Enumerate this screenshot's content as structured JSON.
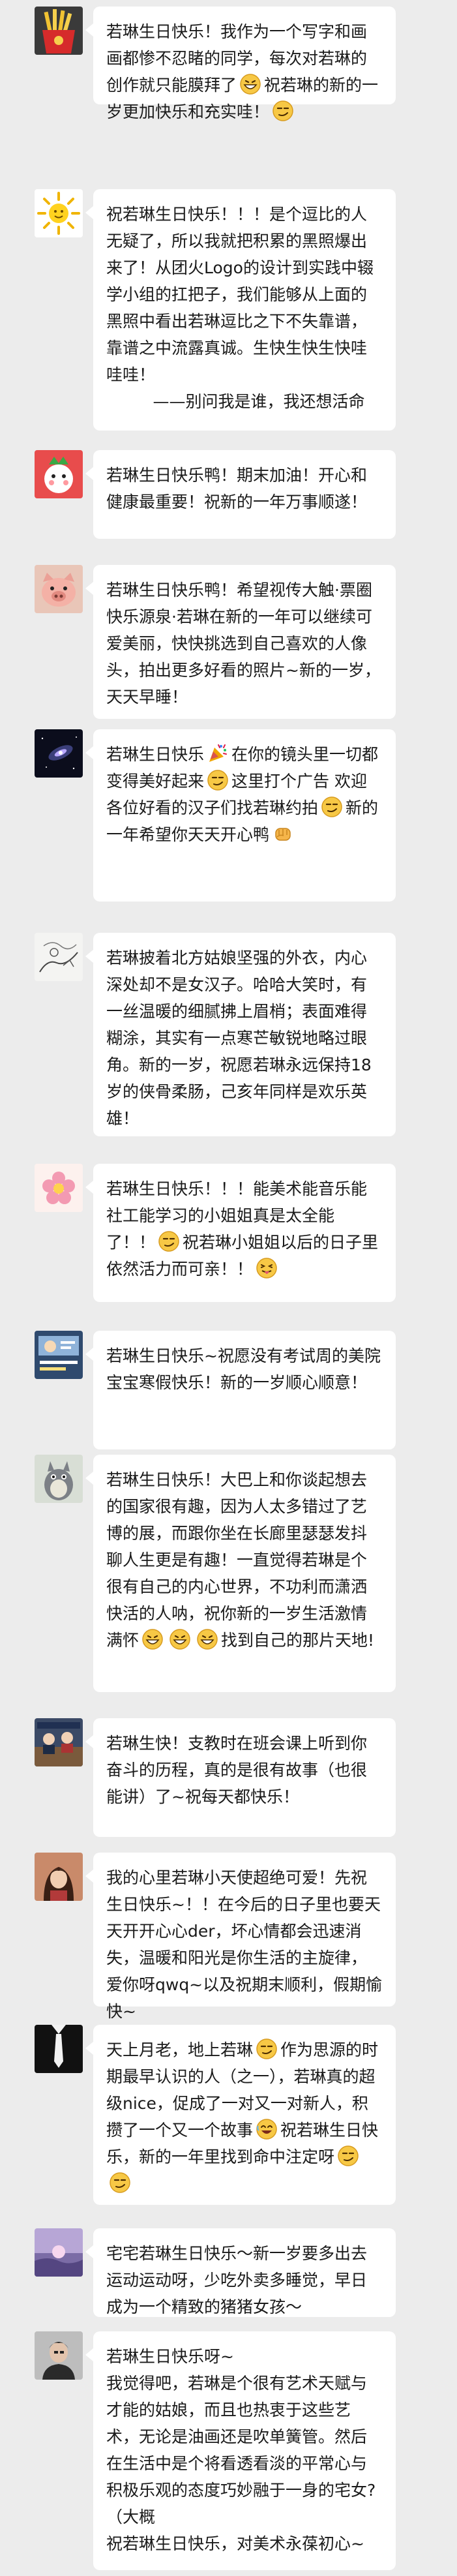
{
  "messages": [
    {
      "avatar": "fries-avatar",
      "segments": [
        {
          "t": "若琳生日快乐！我作为一个写字和画画都惨不忍睹的同学，每次对若琳的创作就只能膜拜了"
        },
        {
          "e": "grin-emoji"
        },
        {
          "t": "祝若琳的新的一岁更加快乐和充实哇！"
        },
        {
          "e": "smirk-emoji"
        }
      ]
    },
    {
      "avatar": "sun-avatar",
      "segments": [
        {
          "t": "祝若琳生日快乐！！！是个逗比的人无疑了，所以我就把积累的黑照爆出来了！从团火Logo的设计到实践中辍学小组的扛把子，我们能够从上面的黑照中看出若琳逗比之下不失靠谱，靠谱之中流露真诚。生快生快生快哇哇哇！\n         ——别问我是谁，我还想活命"
        }
      ]
    },
    {
      "avatar": "strawberry-avatar",
      "segments": [
        {
          "t": "若琳生日快乐鸭！期末加油！开心和健康最重要！祝新的一年万事顺遂！"
        }
      ]
    },
    {
      "avatar": "pig-avatar",
      "segments": [
        {
          "t": "若琳生日快乐鸭！希望视传大触·票圈快乐源泉·若琳在新的一年可以继续可爱美丽，快快挑选到自己喜欢的人像头，拍出更多好看的照片~新的一岁，天天早睡！"
        }
      ]
    },
    {
      "avatar": "galaxy-avatar",
      "segments": [
        {
          "t": "若琳生日快乐"
        },
        {
          "e": "party-emoji"
        },
        {
          "t": "在你的镜头里一切都变得美好起来"
        },
        {
          "e": "smirk-emoji"
        },
        {
          "t": "这里打个广告 欢迎各位好看的汉子们找若琳约拍"
        },
        {
          "e": "smirk-emoji"
        },
        {
          "t": "新的一年希望你天天开心鸭"
        },
        {
          "e": "fist-emoji"
        }
      ]
    },
    {
      "avatar": "sketch-avatar",
      "segments": [
        {
          "t": "若琳披着北方姑娘坚强的外衣，内心深处却不是女汉子。哈哈大笑时，有一丝温暖的细腻拂上眉梢；表面难得糊涂，其实有一点寒芒敏锐地略过眼角。新的一岁，祝愿若琳永远保持18岁的侠骨柔肠，己亥年同样是欢乐英雄！"
        }
      ]
    },
    {
      "avatar": "flower-avatar",
      "segments": [
        {
          "t": "若琳生日快乐！！！能美术能音乐能社工能学习的小姐姐真是太全能了！！"
        },
        {
          "e": "smirk-emoji"
        },
        {
          "t": "祝若琳小姐姐以后的日子里依然活力而可亲！！"
        },
        {
          "e": "tongue-emoji"
        }
      ]
    },
    {
      "avatar": "poster-avatar",
      "segments": [
        {
          "t": "若琳生日快乐~祝愿没有考试周的美院宝宝寒假快乐！新的一岁顺心顺意！"
        }
      ]
    },
    {
      "avatar": "totoro-avatar",
      "segments": [
        {
          "t": "若琳生日快乐！大巴上和你谈起想去的国家很有趣，因为人太多错过了艺博的展，而跟你坐在长廊里瑟瑟发抖聊人生更是有趣！一直觉得若琳是个很有自己的内心世界，不功利而潇洒快活的人呐，祝你新的一岁生活激情满怀"
        },
        {
          "e": "grin-emoji"
        },
        {
          "e": "grin-emoji"
        },
        {
          "e": "grin-emoji"
        },
        {
          "t": "找到自己的那片天地!"
        }
      ]
    },
    {
      "avatar": "meeting-avatar",
      "segments": [
        {
          "t": "若琳生快！支教时在班会课上听到你奋斗的历程，真的是很有故事（也很能讲）了~祝每天都快乐！"
        }
      ]
    },
    {
      "avatar": "girl-avatar",
      "segments": [
        {
          "t": "我的心里若琳小天使超绝可爱！先祝生日快乐~！！在今后的日子里也要天天开开心心der，坏心情都会迅速消失，温暖和阳光是你生活的主旋律，爱你呀qwq~以及祝期末顺利，假期愉快~"
        }
      ]
    },
    {
      "avatar": "tie-avatar",
      "segments": [
        {
          "t": "天上月老，地上若琳"
        },
        {
          "e": "smirk-emoji"
        },
        {
          "t": "作为思源的时期最早认识的人（之一），若琳真的超级nice，促成了一对又一对新人，积攒了一个又一个故事"
        },
        {
          "e": "laugh-emoji"
        },
        {
          "t": "祝若琳生日快乐，新的一年里找到命中注定呀"
        },
        {
          "e": "smirk-emoji"
        },
        {
          "e": "smirk-emoji"
        }
      ]
    },
    {
      "avatar": "sunset-avatar",
      "segments": [
        {
          "t": "宅宅若琳生日快乐～新一岁要多出去运动运动呀，少吃外卖多睡觉，早日成为一个精致的猪猪女孩～"
        }
      ]
    },
    {
      "avatar": "man-avatar",
      "segments": [
        {
          "t": "若琳生日快乐呀~\n我觉得吧，若琳是个很有艺术天赋与才能的姑娘，而且也热衷于这些艺术，无论是油画还是吹单簧管。然后在生活中是个将看透看淡的平常心与积极乐观的态度巧妙融于一身的宅女?（大概\n祝若琳生日快乐，对美术永葆初心~"
        }
      ]
    }
  ]
}
